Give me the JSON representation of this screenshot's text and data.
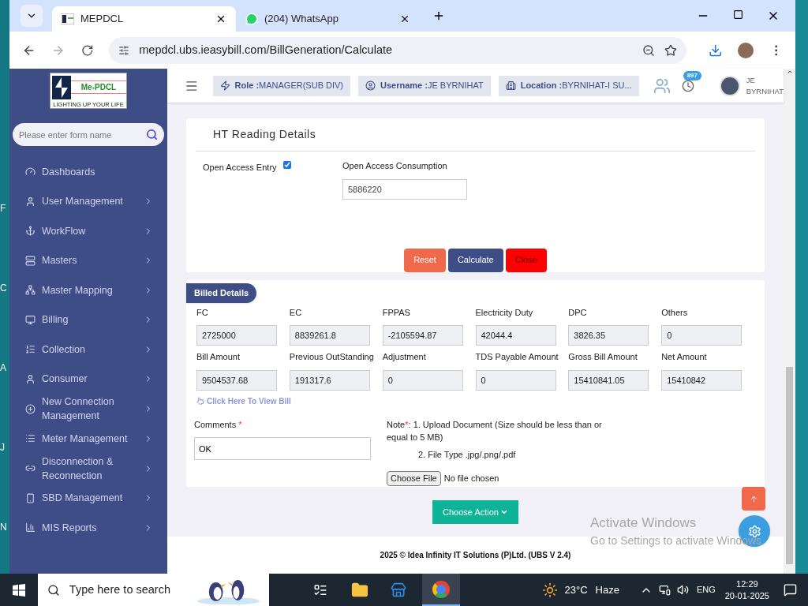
{
  "desktop_labels": [
    "F",
    "C",
    "A",
    "J",
    "N"
  ],
  "browser": {
    "tabs": [
      {
        "title": "MEPDCL",
        "selected": true,
        "kind": "site"
      },
      {
        "title": "(204) WhatsApp",
        "selected": false,
        "kind": "whatsapp"
      }
    ],
    "url": "mepdcl.ubs.ieasybill.com/BillGeneration/Calculate"
  },
  "sidebar": {
    "logo": {
      "name": "Me-PDCL",
      "tagline": "LIGHTING UP YOUR LIFE"
    },
    "search": {
      "placeholder": "Please enter form name"
    },
    "items": [
      {
        "label": "Dashboards",
        "kind": "gauge",
        "has_submenu": false
      },
      {
        "label": "User Management",
        "kind": "user",
        "has_submenu": true
      },
      {
        "label": "WorkFlow",
        "kind": "anchor",
        "has_submenu": true
      },
      {
        "label": "Masters",
        "kind": "server",
        "has_submenu": true
      },
      {
        "label": "Master Mapping",
        "kind": "sitemap",
        "has_submenu": true
      },
      {
        "label": "Billing",
        "kind": "monitor",
        "has_submenu": true
      },
      {
        "label": "Collection",
        "kind": "list-ordered",
        "has_submenu": true
      },
      {
        "label": "Consumer",
        "kind": "user",
        "has_submenu": true
      },
      {
        "label": "New Connection Management",
        "kind": "plus",
        "has_submenu": true
      },
      {
        "label": "Meter Management",
        "kind": "list",
        "has_submenu": true
      },
      {
        "label": "Disconnection & Reconnection",
        "kind": "link",
        "has_submenu": true
      },
      {
        "label": "SBD Management",
        "kind": "phone",
        "has_submenu": true
      },
      {
        "label": "MIS Reports",
        "kind": "chart",
        "has_submenu": true
      }
    ]
  },
  "header": {
    "chips": [
      {
        "label": "Role :",
        "value": "MANAGER(SUB DIV)",
        "kind": "role"
      },
      {
        "label": "Username :",
        "value": "JE BYRNIHAT",
        "kind": "user"
      },
      {
        "label": "Location :",
        "value": "BYRNIHAT-I SU...",
        "kind": "location"
      }
    ],
    "notification_count": "897",
    "user_lines": [
      "JE",
      "BYRNIHAT"
    ]
  },
  "ht_reading": {
    "title": "HT Reading Details",
    "open_access_entry": {
      "label": "Open Access Entry",
      "checked": true
    },
    "consumption": {
      "label": "Open Access Consumption",
      "value": "5886220"
    },
    "buttons": [
      {
        "label": "Reset",
        "kind": "reset"
      },
      {
        "label": "Calculate",
        "kind": "calculate"
      },
      {
        "label": "Close",
        "kind": "close"
      }
    ]
  },
  "billed": {
    "title": "Billed Details",
    "fields": [
      {
        "label": "FC",
        "value": "2725000"
      },
      {
        "label": "EC",
        "value": "8839261.8"
      },
      {
        "label": "FPPAS",
        "value": "-2105594.87"
      },
      {
        "label": "Electricity Duty",
        "value": "42044.4"
      },
      {
        "label": "DPC",
        "value": "3826.35"
      },
      {
        "label": "Others",
        "value": "0"
      },
      {
        "label": "Bill Amount",
        "value": "9504537.68"
      },
      {
        "label": "Previous OutStanding",
        "value": "191317.6"
      },
      {
        "label": "Adjustment",
        "value": "0"
      },
      {
        "label": "TDS Payable Amount",
        "value": "0"
      },
      {
        "label": "Gross Bill Amount",
        "value": "15410841.05"
      },
      {
        "label": "Net Amount",
        "value": "15410842"
      }
    ],
    "view_bill_link": "Click Here To View Bill",
    "comments": {
      "label": "Comments",
      "required_mark": "*",
      "value": "OK"
    },
    "note": {
      "label": "Note",
      "mark": "*",
      "text": ": 1. Upload Document (Size should be less than or equal to 5 MB)",
      "file_types": "2. File Type .jpg/.png/.pdf"
    },
    "file": {
      "button": "Choose File",
      "status": "No file chosen"
    }
  },
  "action_button": "Choose Action",
  "footer": "2025 © Idea Infinity IT Solutions (P)Ltd. (UBS V 2.4)",
  "activation_notice": {
    "title": "Activate Windows",
    "text": "Go to Settings to activate Windows."
  },
  "taskbar": {
    "search_placeholder": "Type here to search",
    "temperature": "23°C",
    "weather": "Haze",
    "language": "ENG",
    "time": "12:29",
    "date": "20-01-2025"
  }
}
